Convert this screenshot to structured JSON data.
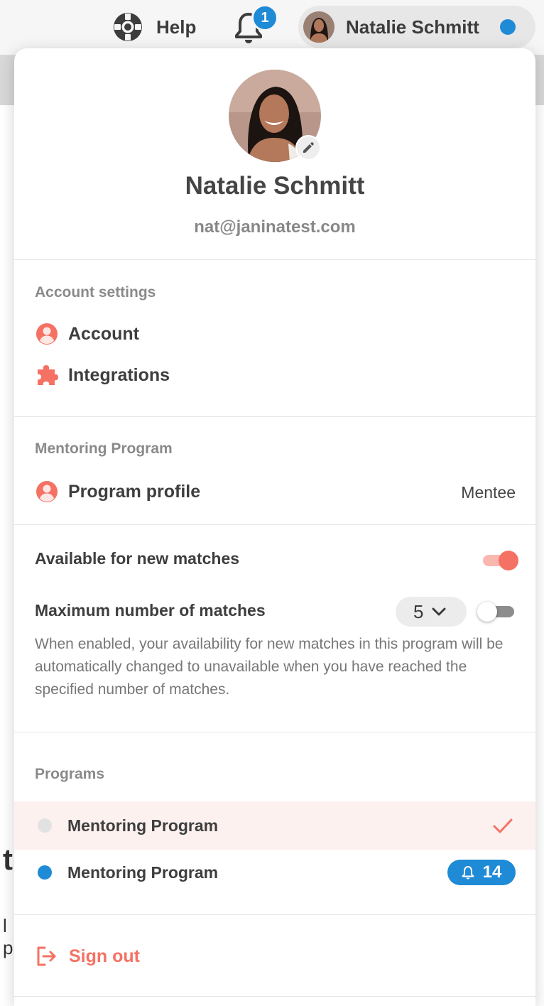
{
  "colors": {
    "accent": "#f57163",
    "accent_light": "#f9b7b0",
    "blue": "#1f8ad6",
    "selected_row_bg": "#fdf1f0",
    "gray_dot": "#e2e2e2"
  },
  "topbar": {
    "help_label": "Help",
    "help_icon": "lifebuoy-icon",
    "bell_icon": "bell-icon",
    "bell_badge_count": "1",
    "user_name": "Natalie Schmitt",
    "status_dot": "online-status-dot"
  },
  "background": {
    "partial_heading": "t",
    "partial_text": "l p"
  },
  "profile": {
    "name": "Natalie Schmitt",
    "email": "nat@janinatest.com",
    "edit_icon": "pencil-icon"
  },
  "account_settings": {
    "title": "Account settings",
    "items": [
      {
        "label": "Account",
        "icon": "user-circle-icon"
      },
      {
        "label": "Integrations",
        "icon": "puzzle-icon"
      }
    ]
  },
  "mentoring_program": {
    "title": "Mentoring Program",
    "profile_label": "Program profile",
    "profile_icon": "user-circle-icon",
    "role": "Mentee"
  },
  "availability": {
    "available_label": "Available for new matches",
    "available_enabled": true,
    "max_label": "Maximum number of matches",
    "max_value": "5",
    "max_enabled": false,
    "help_text": "When enabled, your availability for new matches in this program will be automatically changed to unavailable when you have reached the specified number of matches."
  },
  "programs": {
    "title": "Programs",
    "items": [
      {
        "name": "Mentoring Program",
        "selected": true,
        "dot_color": "#e2e2e2"
      },
      {
        "name": "Mentoring Program",
        "selected": false,
        "dot_color": "#1f8ad6",
        "notification_count": "14"
      }
    ]
  },
  "sign_out": {
    "label": "Sign out",
    "icon": "sign-out-icon"
  }
}
